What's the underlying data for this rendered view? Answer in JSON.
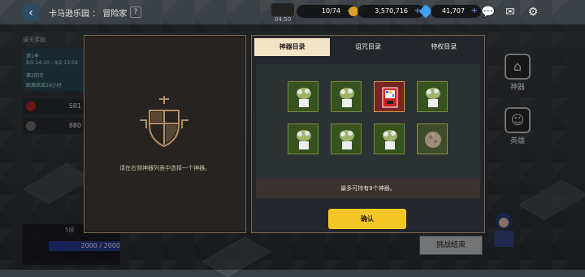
{
  "header": {
    "back_icon": "back-arrow-icon",
    "title": "卡马逊乐园 ： 冒险家",
    "help": "?",
    "timer": "04:50",
    "stamina": "10/74",
    "gold": "3,570,716",
    "gems": "41,707",
    "plus": "+"
  },
  "left_panel": {
    "header": "通关奖励",
    "season": "第1季",
    "dates": "8/5 14:10 - 9/2 13:59",
    "round": "第2回合",
    "countdown": "距离结束26小时",
    "resource1": "581",
    "resource2": "880",
    "level": "5层",
    "progress": "2000 / 2000"
  },
  "side": {
    "artifact_label": "神器",
    "hero_label": "英雄",
    "challenge_end": "挑战结束"
  },
  "modal": {
    "left_hint": "请在右侧神器列表中选择一个神器。",
    "tabs": [
      {
        "label": "神器目录",
        "active": true
      },
      {
        "label": "诅咒目录",
        "active": false
      },
      {
        "label": "特权目录",
        "active": false
      }
    ],
    "slots": [
      {
        "icon": "potted-plant-icon"
      },
      {
        "icon": "potted-plant-icon"
      },
      {
        "icon": "vending-machine-icon"
      },
      {
        "icon": "potted-plant-icon"
      },
      {
        "icon": "potted-plant-icon"
      },
      {
        "icon": "potted-plant-icon"
      },
      {
        "icon": "potted-plant-icon"
      },
      {
        "icon": "round-stone-icon"
      }
    ],
    "info": "最多可持有8个神器。",
    "confirm": "确认"
  },
  "colors": {
    "confirm_yellow": "#f2c725",
    "tab_active": "#f3e4c8",
    "frame_gold": "#7a6a4c"
  }
}
